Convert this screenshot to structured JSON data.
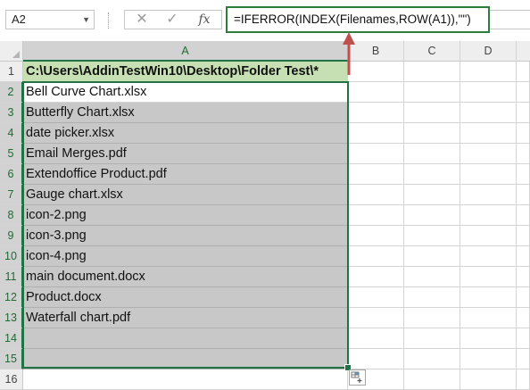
{
  "formula_bar": {
    "name_box": "A2",
    "cancel_icon": "✕",
    "enter_icon": "✓",
    "fx_label": "fx",
    "formula": "=IFERROR(INDEX(Filenames,ROW(A1)),\"\")"
  },
  "columns": [
    "A",
    "B",
    "C",
    "D"
  ],
  "rows": [
    {
      "num": "1",
      "value": "C:\\Users\\AddinTestWin10\\Desktop\\Folder Test\\*"
    },
    {
      "num": "2",
      "value": "Bell Curve Chart.xlsx"
    },
    {
      "num": "3",
      "value": "Butterfly Chart.xlsx"
    },
    {
      "num": "4",
      "value": "date picker.xlsx"
    },
    {
      "num": "5",
      "value": "Email Merges.pdf"
    },
    {
      "num": "6",
      "value": "Extendoffice Product.pdf"
    },
    {
      "num": "7",
      "value": "Gauge chart.xlsx"
    },
    {
      "num": "8",
      "value": "icon-2.png"
    },
    {
      "num": "9",
      "value": "icon-3.png"
    },
    {
      "num": "10",
      "value": "icon-4.png"
    },
    {
      "num": "11",
      "value": "main document.docx"
    },
    {
      "num": "12",
      "value": "Product.docx"
    },
    {
      "num": "13",
      "value": "Waterfall chart.pdf"
    },
    {
      "num": "14",
      "value": ""
    },
    {
      "num": "15",
      "value": ""
    },
    {
      "num": "16",
      "value": ""
    }
  ],
  "colors": {
    "header_fill": "#c6e0b4",
    "selection_fill": "#c8c8c8",
    "selection_border": "#217346",
    "arrow": "#c0504d"
  },
  "quick_analysis_icon": "quick-analysis-icon"
}
